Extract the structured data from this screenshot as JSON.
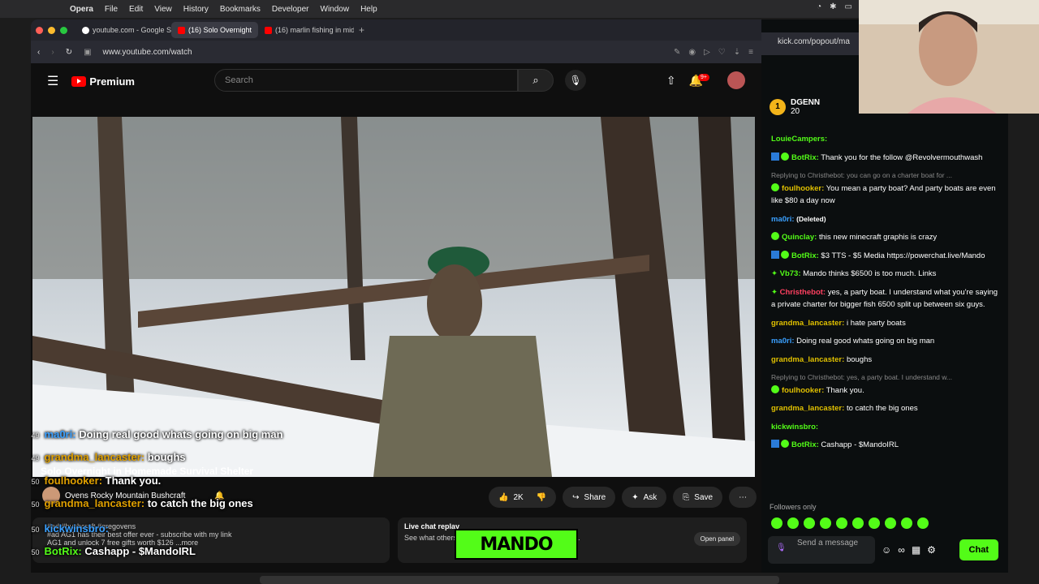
{
  "menubar": {
    "app": "Opera",
    "items": [
      "File",
      "Edit",
      "View",
      "History",
      "Bookmarks",
      "Developer",
      "Window",
      "Help"
    ]
  },
  "tabs": [
    {
      "label": "youtube.com - Google S"
    },
    {
      "label": "(16) Solo Overnight"
    },
    {
      "label": "(16) marlin fishing in mid"
    }
  ],
  "address": {
    "url": "www.youtube.com/watch"
  },
  "youtube": {
    "logo": "Premium",
    "search_placeholder": "Search",
    "notif_count": "9+",
    "title": "Solo Overnight in Homemade Survival Shelter",
    "channel": "Ovens Rocky Mountain Bushcraft",
    "likes": "2K",
    "share": "Share",
    "ask": "Ask",
    "save": "Save",
    "desc_line1": "#ad #bushcraft #gregovens",
    "desc_line2": "#ad AG1 has their best offer ever - subscribe with my link",
    "desc_line3": "AG1 and unlock 7 free gifts worth $126 ...more",
    "livechat_title": "Live chat replay",
    "livechat_text": "See what others said about this video while it was live.",
    "open_panel": "Open panel"
  },
  "overlay": [
    {
      "ts": "01:49",
      "user": "ma0ri:",
      "text": "Doing real good whats going on big man",
      "color": "#3aa0ff"
    },
    {
      "ts": "01:49",
      "user": "grandma_lancaster:",
      "text": "boughs",
      "color": "#e0a000"
    },
    {
      "ts": "01:50",
      "user": "foulhooker:",
      "text": "Thank you.",
      "color": "#e0a000"
    },
    {
      "ts": "01:50",
      "user": "grandma_lancaster:",
      "text": "to catch the big ones",
      "color": "#e0a000"
    },
    {
      "ts": "01:50",
      "user": "kickwinsbro:",
      "text": "",
      "color": "#3aa0ff"
    },
    {
      "ts": "01:50",
      "user": "BotRix:",
      "text": "Cashapp - $MandoIRL",
      "color": "#53fc18"
    }
  ],
  "mando": "MANDO",
  "kick": {
    "url": "kick.com/popout/ma",
    "pinned_user": "DGENN",
    "pinned_num": "20",
    "followers_only": "Followers only",
    "send_placeholder": "Send a message",
    "chat_button": "Chat",
    "messages": [
      {
        "user": "LouieCampers:",
        "text": "",
        "color": "#53fc18",
        "reply": ""
      },
      {
        "user": "BotRix:",
        "text": "Thank you for the follow @Revolvermouthwash",
        "color": "#53fc18",
        "reply": ""
      },
      {
        "user": "foulhooker:",
        "text": "You mean a party boat? And party boats are even like $80 a day now",
        "color": "#e0c000",
        "reply": "Replying to Christhebot: you can go on a charter boat for ..."
      },
      {
        "user": "ma0ri:",
        "text": "(Deleted)",
        "color": "#3aa0ff",
        "reply": ""
      },
      {
        "user": "Quinclay:",
        "text": "this new minecraft graphis is crazy",
        "color": "#53fc18",
        "reply": ""
      },
      {
        "user": "BotRix:",
        "text": "$3 TTS - $5 Media https://powerchat.live/Mando",
        "color": "#53fc18",
        "reply": ""
      },
      {
        "user": "Vb73:",
        "text": "Mando thinks $6500 is too much. Links",
        "color": "#53fc18",
        "reply": ""
      },
      {
        "user": "Christhebot:",
        "text": "yes, a party boat. I understand what you're saying a private charter for bigger fish 6500 split up between six guys.",
        "color": "#ff4060",
        "reply": ""
      },
      {
        "user": "grandma_lancaster:",
        "text": "i hate party boats",
        "color": "#e0c000",
        "reply": ""
      },
      {
        "user": "ma0ri:",
        "text": "Doing real good whats going on big man",
        "color": "#3aa0ff",
        "reply": ""
      },
      {
        "user": "grandma_lancaster:",
        "text": "boughs",
        "color": "#e0c000",
        "reply": ""
      },
      {
        "user": "foulhooker:",
        "text": "Thank you.",
        "color": "#e0c000",
        "reply": "Replying to Christhebot: yes, a party boat. I understand w..."
      },
      {
        "user": "grandma_lancaster:",
        "text": "to catch the big ones",
        "color": "#e0c000",
        "reply": ""
      },
      {
        "user": "kickwinsbro:",
        "text": "",
        "color": "#53fc18",
        "reply": ""
      },
      {
        "user": "BotRix:",
        "text": "Cashapp - $MandoIRL",
        "color": "#53fc18",
        "reply": ""
      }
    ]
  },
  "colors": {
    "kick_green": "#53fc18",
    "yt_red": "#ff0000"
  }
}
